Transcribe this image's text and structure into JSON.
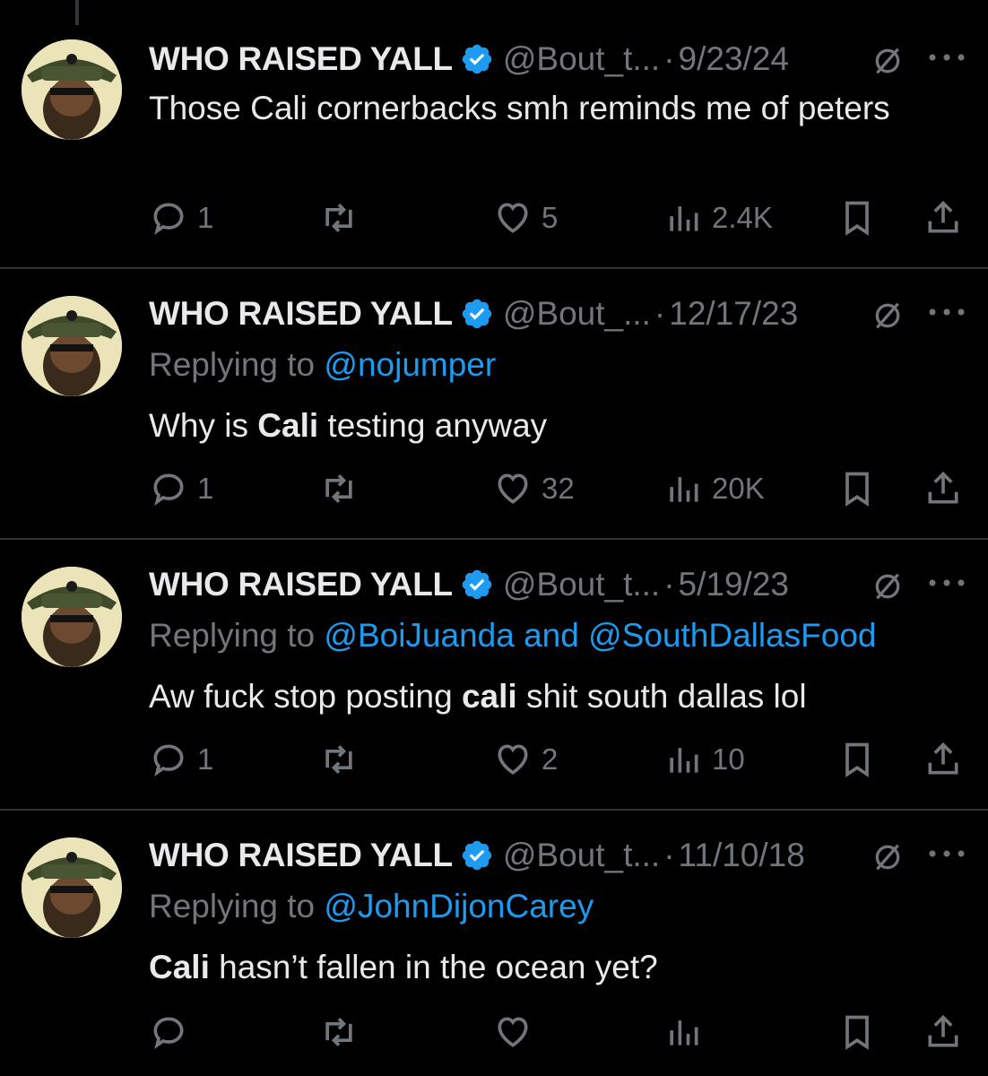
{
  "tweets": [
    {
      "name": "WHO RAISED YALL",
      "handle": "@Bout_t...",
      "date": "9/23/24",
      "replying_prefix": "",
      "replying_to": "",
      "body_pre": "Those Cali cornerbacks smh reminds me of peters",
      "body_bold": "",
      "body_post": "",
      "replies": "1",
      "retweets": "",
      "likes": "5",
      "views": "2.4K"
    },
    {
      "name": "WHO RAISED YALL",
      "handle": "@Bout_...",
      "date": "12/17/23",
      "replying_prefix": "Replying to ",
      "replying_to": "@nojumper",
      "body_pre": "Why is ",
      "body_bold": "Cali",
      "body_post": " testing anyway",
      "replies": "1",
      "retweets": "",
      "likes": "32",
      "views": "20K"
    },
    {
      "name": "WHO RAISED YALL",
      "handle": "@Bout_t...",
      "date": "5/19/23",
      "replying_prefix": "Replying to ",
      "replying_to": "@BoiJuanda and @SouthDallasFood",
      "body_pre": "Aw fuck stop posting ",
      "body_bold": "cali",
      "body_post": " shit south dallas lol",
      "replies": "1",
      "retweets": "",
      "likes": "2",
      "views": "10"
    },
    {
      "name": "WHO RAISED YALL",
      "handle": "@Bout_t...",
      "date": "11/10/18",
      "replying_prefix": "Replying to ",
      "replying_to": "@JohnDijonCarey",
      "body_pre": "",
      "body_bold": "Cali",
      "body_post": " hasn’t fallen in the ocean yet?",
      "replies": "",
      "retweets": "",
      "likes": "",
      "views": ""
    }
  ],
  "dot_separator": "·",
  "icons": {
    "verified": "verified-badge-icon",
    "muted": "muted-slash-icon",
    "more": "more-dots-icon",
    "reply": "reply-bubble-icon",
    "retweet": "retweet-icon",
    "like": "heart-icon",
    "views": "views-bars-icon",
    "bookmark": "bookmark-icon",
    "share": "share-icon"
  },
  "colors": {
    "background": "#000000",
    "text": "#e7e9ea",
    "muted": "#71767b",
    "link": "#1d9bf0",
    "divider": "#2f3336"
  }
}
